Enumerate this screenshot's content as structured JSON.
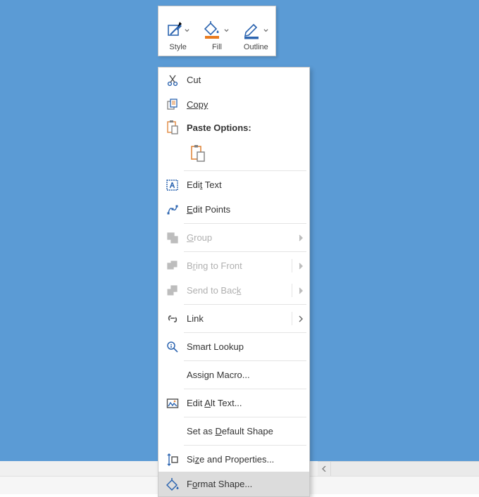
{
  "miniToolbar": {
    "style": {
      "label": "Style"
    },
    "fill": {
      "label": "Fill",
      "accent": "#e97b1f"
    },
    "outline": {
      "label": "Outline",
      "accent": "#2d65b0"
    }
  },
  "contextMenu": {
    "cut": "Cut",
    "copy": "Copy",
    "pasteOptions": "Paste Options:",
    "editText_pre": "Edi",
    "editText_u": "t",
    "editText_post": " Text",
    "editPoints_pre": "",
    "editPoints_u": "E",
    "editPoints_post": "dit Points",
    "group_pre": "",
    "group_u": "G",
    "group_post": "roup",
    "bringFront_pre": "B",
    "bringFront_u": "r",
    "bringFront_post": "ing to Front",
    "sendBack_pre": "Send to Bac",
    "sendBack_u": "k",
    "sendBack_post": "",
    "link": "Link",
    "smartLookup": "Smart Lookup",
    "assignMacro_pre": "Assi",
    "assignMacro_u": "g",
    "assignMacro_post": "n Macro...",
    "editAlt_pre": "Edit ",
    "editAlt_u": "A",
    "editAlt_post": "lt Text...",
    "setDefault_pre": "Set as ",
    "setDefault_u": "D",
    "setDefault_post": "efault Shape",
    "sizeProps_pre": "Si",
    "sizeProps_u": "z",
    "sizeProps_post": "e and Properties...",
    "formatShape_pre": "F",
    "formatShape_u": "o",
    "formatShape_post": "rmat Shape..."
  }
}
